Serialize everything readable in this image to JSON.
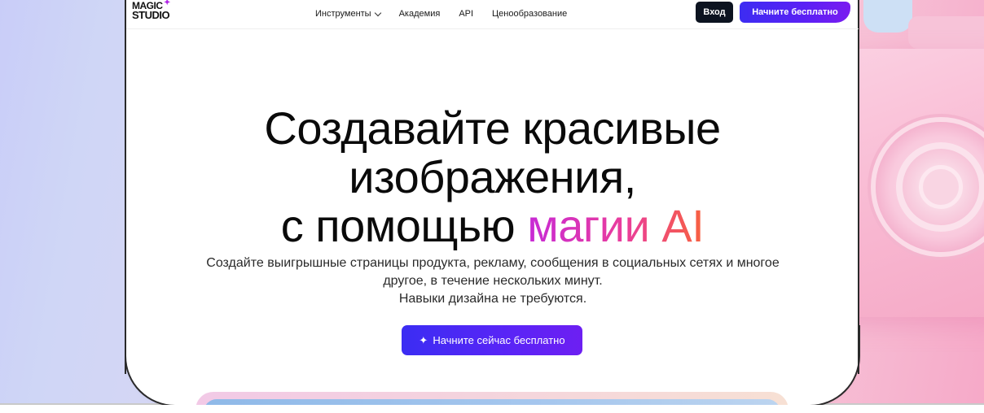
{
  "brand": {
    "logo_line1": "MAGIC",
    "logo_line2": "STUDIO",
    "logo_mark": "✦"
  },
  "nav": {
    "tools_label": "Инструменты",
    "academy_label": "Академия",
    "api_label": "API",
    "pricing_label": "Ценообразование",
    "login_label": "Вход",
    "start_label": "Начните бесплатно"
  },
  "hero": {
    "title_line1": "Создавайте красивые",
    "title_line2": "изображения,",
    "title_line3_prefix": "с помощью",
    "title_line3_highlight": "магии AI",
    "subtitle_line1": "Создайте выигрышные страницы продукта, рекламу, сообщения в социальных сетях и многое",
    "subtitle_line2": "другое, в течение нескольких минут.",
    "subtitle_line3": "Навыки дизайна не требуются.",
    "cta_label": "Начните сейчас бесплатно",
    "cta_icon": "sparkle-icon"
  },
  "colors": {
    "accent_start": "#3b2df3",
    "accent_end": "#7a1cf0",
    "login_bg": "#0c1320",
    "highlight_gradient": [
      "#c72ad6",
      "#ea3d9c",
      "#f7613f"
    ]
  }
}
